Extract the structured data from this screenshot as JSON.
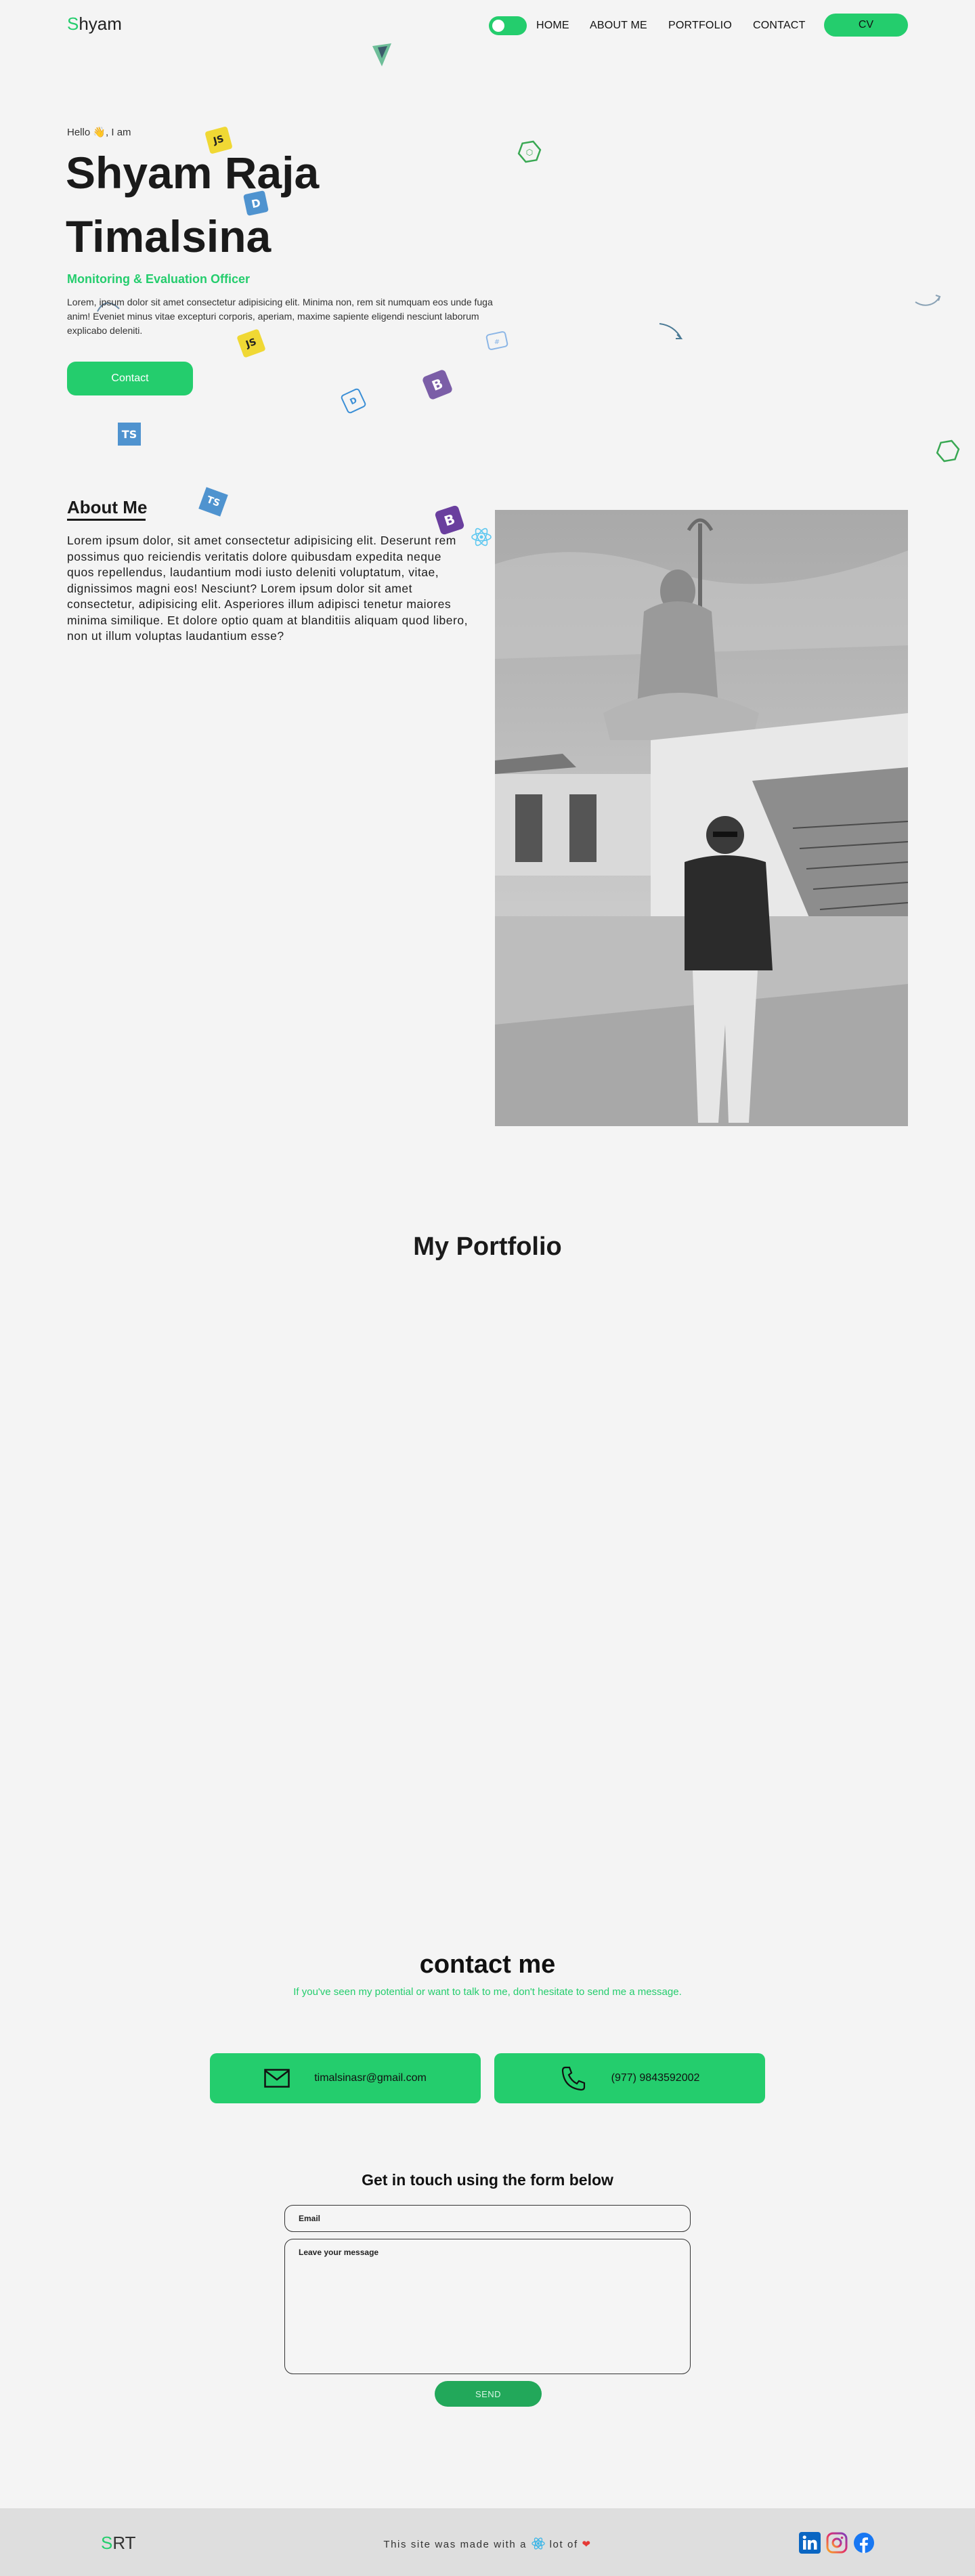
{
  "nav": {
    "logo_first": "S",
    "logo_rest": "hyam",
    "links": [
      "HOME",
      "ABOUT ME",
      "PORTFOLIO",
      "CONTACT"
    ],
    "cv_label": "CV"
  },
  "hero": {
    "hello": "Hello 👋, I am",
    "name": "Shyam Raja Timalsina",
    "role": "Monitoring & Evaluation Officer",
    "text": "Lorem, ipsum dolor sit amet consectetur adipisicing elit. Minima non, rem sit numquam eos unde fuga anim! Eveniet minus vitae excepturi corporis, aperiam, maxime sapiente eligendi nesciunt laborum explicabo deleniti.",
    "contact_label": "Contact",
    "floating_icons": [
      "JS",
      "TS",
      "B"
    ]
  },
  "about": {
    "title": "About Me",
    "text": "Lorem ipsum dolor, sit amet consectetur adipisicing elit. Deserunt rem possimus quo reiciendis veritatis dolore quibusdam expedita neque quos repellendus, laudantium modi iusto deleniti voluptatum, vitae, dignissimos magni eos! Nesciunt? Lorem ipsum dolor sit amet consectetur, adipisicing elit. Asperiores illum adipisci tenetur maiores minima similique. Et dolore optio quam at blanditiis aliquam quod libero, non ut illum voluptas laudantium esse?"
  },
  "portfolio": {
    "title": "My Portfolio"
  },
  "contact": {
    "title": "contact me",
    "subtitle": "If you've seen my potential or want to talk to me, don't hesitate to send me a message.",
    "email": "timalsinasr@gmail.com",
    "phone": "(977) 9843592002",
    "form_title": "Get in touch using the form below",
    "email_placeholder": "Email",
    "message_placeholder": "Leave your message",
    "send_label": "SEND"
  },
  "footer": {
    "logo_first": "S",
    "logo_rest": "RT",
    "text_before": "This site was made with a",
    "text_middle": "lot of",
    "socials": [
      "linkedin-icon",
      "instagram-icon",
      "facebook-icon"
    ]
  },
  "colors": {
    "accent": "#24cd6d",
    "background": "#f4f4f4",
    "footer": "#dedede"
  }
}
